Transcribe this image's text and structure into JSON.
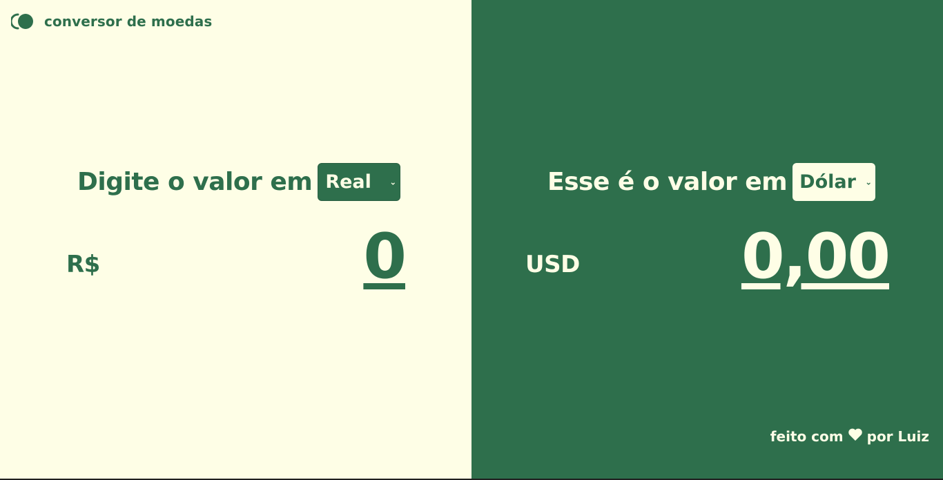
{
  "brand": {
    "name": "conversor de moedas",
    "icon": "toggle-icon"
  },
  "source": {
    "heading": "Digite o valor em",
    "currency_selected": "Real",
    "currency_symbol": "R$",
    "amount": "0"
  },
  "target": {
    "heading": "Esse é o valor em",
    "currency_selected": "Dólar",
    "currency_symbol": "USD",
    "amount": "0,00"
  },
  "footer": {
    "prefix": "feito com",
    "icon": "heart-icon",
    "suffix": "por Luiz"
  },
  "colors": {
    "cream": "#fefee6",
    "green": "#2e6f4c"
  }
}
